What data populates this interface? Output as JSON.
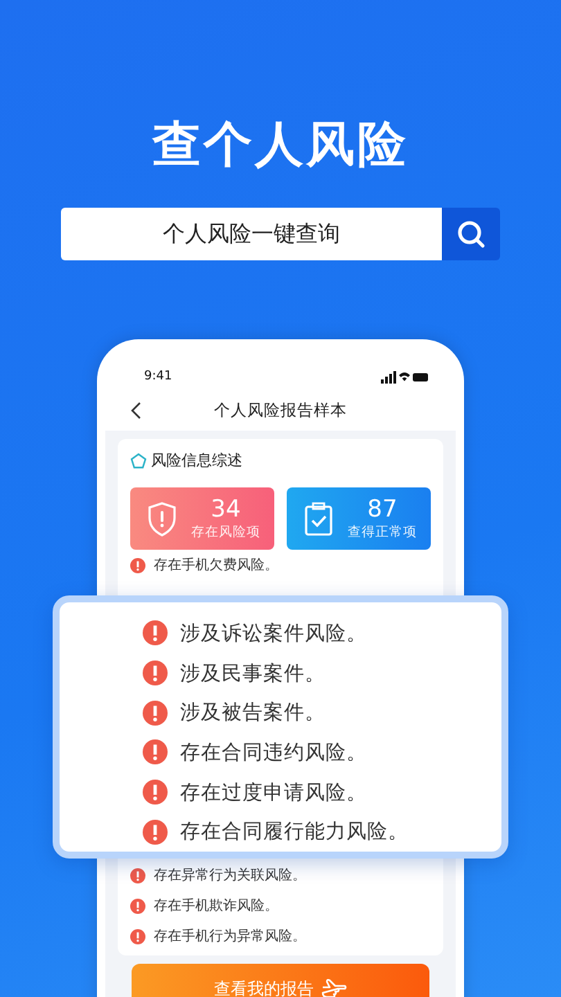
{
  "headline": "查个人风险",
  "search": {
    "value": "个人风险一键查询"
  },
  "phone": {
    "status_time": "9:41",
    "nav_title": "个人风险报告样本",
    "card_title": "风险信息综述",
    "stats": [
      {
        "kind": "risk",
        "value": "34",
        "label": "存在风险项"
      },
      {
        "kind": "normal",
        "value": "87",
        "label": "查得正常项"
      }
    ],
    "items_top": [
      "存在手机欠费风险。"
    ],
    "items_bottom": [
      "存在异常行为关联风险。",
      "存在手机欺诈风险。",
      "存在手机行为异常风险。"
    ],
    "button": "查看我的报告"
  },
  "popup": {
    "items": [
      "涉及诉讼案件风险。",
      "涉及民事案件。",
      "涉及被告案件。",
      "存在合同违约风险。",
      "存在过度申请风险。",
      "存在合同履行能力风险。"
    ]
  }
}
